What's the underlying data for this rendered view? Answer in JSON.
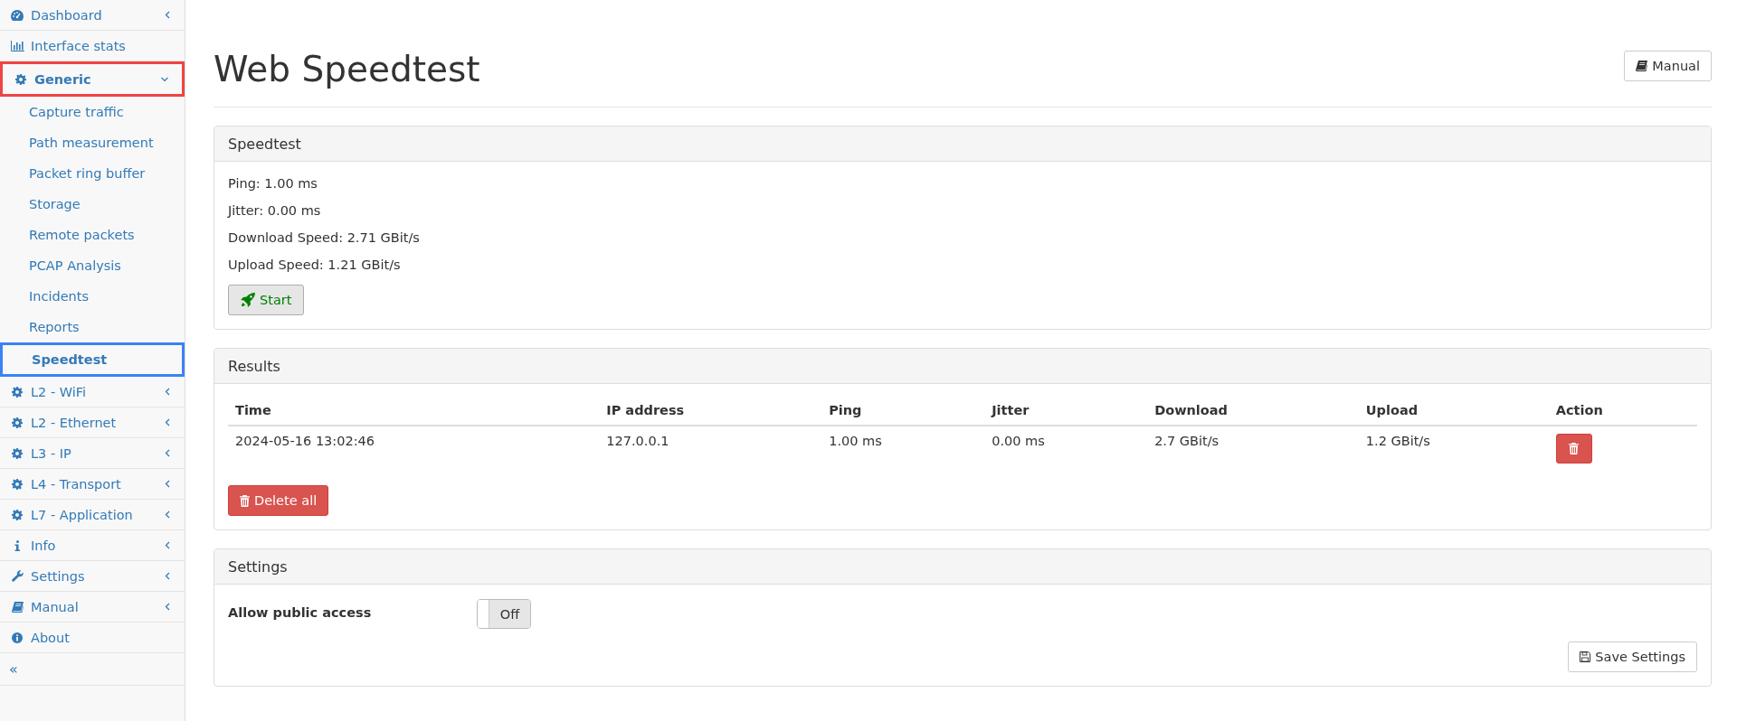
{
  "sidebar": {
    "items": [
      {
        "kind": "group",
        "label": "Dashboard",
        "expanded": false
      },
      {
        "kind": "link",
        "label": "Interface stats"
      },
      {
        "kind": "group",
        "label": "Generic",
        "expanded": true,
        "children": [
          {
            "label": "Capture traffic",
            "selected": false
          },
          {
            "label": "Path measurement",
            "selected": false
          },
          {
            "label": "Packet ring buffer",
            "selected": false
          },
          {
            "label": "Storage",
            "selected": false
          },
          {
            "label": "Remote packets",
            "selected": false
          },
          {
            "label": "PCAP Analysis",
            "selected": false
          },
          {
            "label": "Incidents",
            "selected": false
          },
          {
            "label": "Reports",
            "selected": false
          },
          {
            "label": "Speedtest",
            "selected": true
          }
        ]
      },
      {
        "kind": "group",
        "label": "L2 - WiFi",
        "expanded": false
      },
      {
        "kind": "group",
        "label": "L2 - Ethernet",
        "expanded": false
      },
      {
        "kind": "group",
        "label": "L3 - IP",
        "expanded": false
      },
      {
        "kind": "group",
        "label": "L4 - Transport",
        "expanded": false
      },
      {
        "kind": "group",
        "label": "L7 - Application",
        "expanded": false
      },
      {
        "kind": "group",
        "label": "Info",
        "expanded": false
      },
      {
        "kind": "group",
        "label": "Settings",
        "expanded": false
      },
      {
        "kind": "group",
        "label": "Manual",
        "expanded": false
      },
      {
        "kind": "link",
        "label": "About"
      }
    ],
    "collapse_label": "«"
  },
  "page": {
    "title": "Web Speedtest",
    "manual_button": "Manual"
  },
  "speedtest": {
    "title": "Speedtest",
    "lines": [
      "Ping: 1.00 ms",
      "Jitter: 0.00 ms",
      "Download Speed: 2.71 GBit/s",
      "Upload Speed: 1.21 GBit/s"
    ],
    "start_button": "Start"
  },
  "results": {
    "title": "Results",
    "columns": [
      "Time",
      "IP address",
      "Ping",
      "Jitter",
      "Download",
      "Upload",
      "Action"
    ],
    "rows": [
      {
        "cells": [
          "2024-05-16 13:02:46",
          "127.0.0.1",
          "1.00 ms",
          "0.00 ms",
          "2.7 GBit/s",
          "1.2 GBit/s"
        ]
      }
    ],
    "delete_all_button": "Delete all"
  },
  "settings": {
    "title": "Settings",
    "fields": [
      {
        "kind": "toggle",
        "label": "Allow public access",
        "on": false,
        "state_label": "Off"
      }
    ],
    "save_button": "Save Settings"
  }
}
